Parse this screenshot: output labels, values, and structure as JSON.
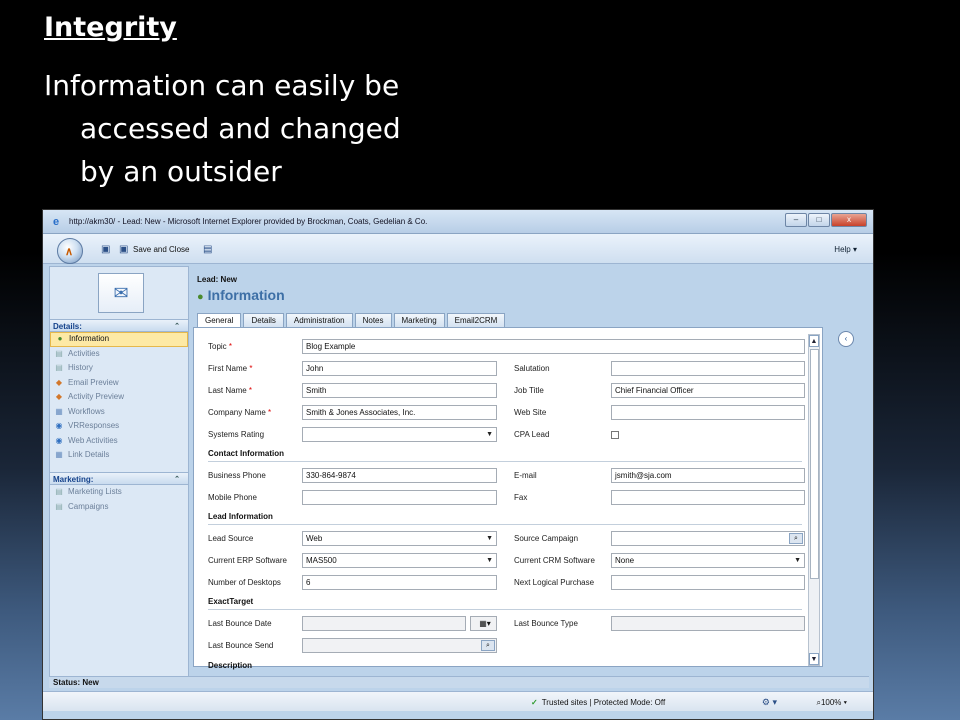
{
  "slide": {
    "title": "Integrity",
    "line1": "Information can easily be",
    "line2": "accessed and changed",
    "line3": "by an outsider"
  },
  "window": {
    "title": "http://akm30/ - Lead: New - Microsoft Internet Explorer provided by Brockman, Coats, Gedelian & Co.",
    "min": "–",
    "max": "□",
    "close": "x"
  },
  "toolbar": {
    "save_close": "Save and Close",
    "help": "Help ▾"
  },
  "header": {
    "label": "Lead: New",
    "title": "Information"
  },
  "nav": {
    "details_head": "Details:",
    "details": [
      "Information",
      "Activities",
      "History",
      "Email Preview",
      "Activity Preview",
      "Workflows",
      "VRResponses",
      "Web Activities",
      "Link Details"
    ],
    "marketing_head": "Marketing:",
    "marketing": [
      "Marketing Lists",
      "Campaigns"
    ]
  },
  "tabs": [
    "General",
    "Details",
    "Administration",
    "Notes",
    "Marketing",
    "Email2CRM"
  ],
  "form": {
    "topic_label": "Topic",
    "topic": "Blog Example",
    "first_name_label": "First Name",
    "first_name": "John",
    "salutation_label": "Salutation",
    "salutation": "",
    "last_name_label": "Last Name",
    "last_name": "Smith",
    "job_title_label": "Job Title",
    "job_title": "Chief Financial Officer",
    "company_label": "Company Name",
    "company": "Smith & Jones Associates, Inc.",
    "website_label": "Web Site",
    "website": "",
    "systems_rating_label": "Systems Rating",
    "systems_rating": "",
    "cpa_lead_label": "CPA Lead",
    "contact_section": "Contact Information",
    "business_phone_label": "Business Phone",
    "business_phone": "330-864-9874",
    "email_label": "E-mail",
    "email": "jsmith@sja.com",
    "mobile_label": "Mobile Phone",
    "mobile": "",
    "fax_label": "Fax",
    "fax": "",
    "lead_section": "Lead Information",
    "lead_source_label": "Lead Source",
    "lead_source": "Web",
    "source_campaign_label": "Source Campaign",
    "source_campaign": "",
    "erp_label": "Current ERP Software",
    "erp": "MAS500",
    "crm_label": "Current CRM Software",
    "crm": "None",
    "desktops_label": "Number of Desktops",
    "desktops": "6",
    "next_purchase_label": "Next Logical Purchase",
    "next_purchase": "",
    "exact_section": "ExactTarget",
    "bounce_date_label": "Last Bounce Date",
    "bounce_type_label": "Last Bounce Type",
    "bounce_send_label": "Last Bounce Send",
    "description_section": "Description"
  },
  "status": {
    "form_status": "Status: New",
    "trusted": "Trusted sites | Protected Mode: Off",
    "zoom": "100%"
  }
}
